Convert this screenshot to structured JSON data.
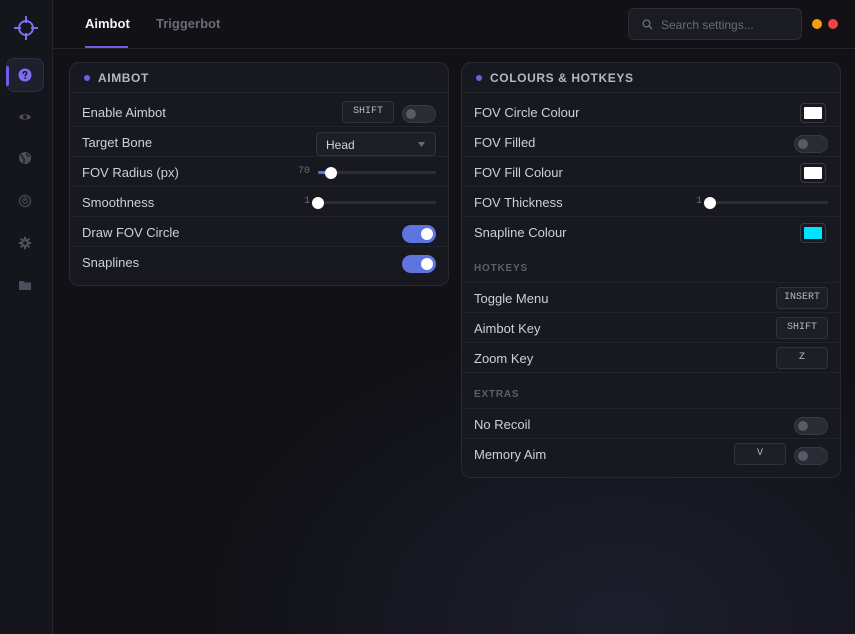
{
  "tabs": [
    {
      "label": "Aimbot",
      "active": true
    },
    {
      "label": "Triggerbot",
      "active": false
    }
  ],
  "search": {
    "placeholder": "Search settings..."
  },
  "sidebar": {
    "icons": [
      "help-icon",
      "eye-icon",
      "globe-icon",
      "radar-icon",
      "gear-icon",
      "folder-icon"
    ],
    "active_index": 0
  },
  "window_dots": {
    "minimize_color": "#f59e0b",
    "close_color": "#ef4444"
  },
  "aimbot": {
    "title": "AIMBOT",
    "enable_aimbot": {
      "label": "Enable Aimbot",
      "key": "SHIFT",
      "on": false
    },
    "target_bone": {
      "label": "Target Bone",
      "value": "Head"
    },
    "fov_radius": {
      "label": "FOV Radius (px)",
      "value": "70",
      "fraction": 0.11
    },
    "smoothness": {
      "label": "Smoothness",
      "value": "1",
      "fraction": 0.0
    },
    "draw_fov_circle": {
      "label": "Draw FOV Circle",
      "on": true
    },
    "snaplines": {
      "label": "Snaplines",
      "on": true
    }
  },
  "colours": {
    "title": "COLOURS & HOTKEYS",
    "fov_circle_colour": {
      "label": "FOV Circle Colour",
      "color": "#ffffff"
    },
    "fov_filled": {
      "label": "FOV Filled",
      "on": false
    },
    "fov_fill_colour": {
      "label": "FOV Fill Colour",
      "color": "#ffffff"
    },
    "fov_thickness": {
      "label": "FOV Thickness",
      "value": "1",
      "fraction": 0.0
    },
    "snapline_colour": {
      "label": "Snapline Colour",
      "color": "#00e5ff"
    },
    "hotkeys_heading": "HOTKEYS",
    "toggle_menu": {
      "label": "Toggle Menu",
      "key": "INSERT"
    },
    "aimbot_key": {
      "label": "Aimbot Key",
      "key": "SHIFT"
    },
    "zoom_key": {
      "label": "Zoom Key",
      "key": "Z"
    },
    "extras_heading": "EXTRAS",
    "no_recoil": {
      "label": "No Recoil",
      "on": false
    },
    "memory_aim": {
      "label": "Memory Aim",
      "key": "V",
      "on": false
    }
  }
}
